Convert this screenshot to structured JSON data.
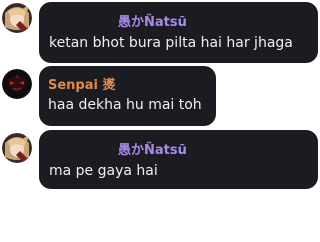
{
  "messages": [
    {
      "author": "愚かÑatsū",
      "text": "ketan bhot bura pilta hai har jhaga",
      "avatar": "anime-girl-avatar"
    },
    {
      "author": "Senpai 㸂",
      "text": "haa dekha hu mai toh",
      "avatar": "dark-red-mask-avatar"
    },
    {
      "author": "愚かÑatsū",
      "text": "ma pe gaya hai",
      "avatar": "anime-girl-avatar"
    }
  ],
  "colors": {
    "bubble": "#1b1b22",
    "author_purple": "#a98be8",
    "author_orange": "#e08a4a",
    "text": "#f0f0f2"
  }
}
